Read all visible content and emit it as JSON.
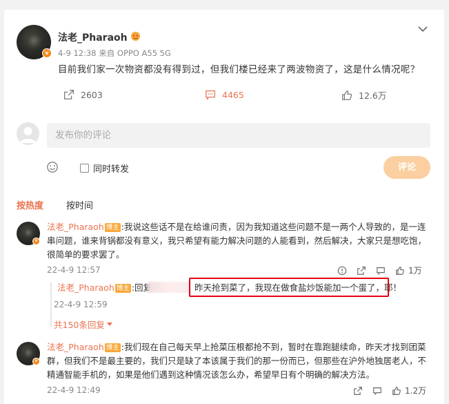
{
  "post": {
    "author": "法老_Pharaoh",
    "meta": "4-9 12:38 来自 OPPO A55 5G",
    "text": "目前我们家一次物资都没有得到过，但我们楼已经来了两波物资了，这是什么情况呢？",
    "repost_count": "2603",
    "comment_count": "4465",
    "like_count": "12.6万"
  },
  "comment_input": {
    "placeholder": "发布你的评论",
    "repost_option": "同时转发",
    "submit": "评论"
  },
  "tabs": [
    "按热度",
    "按时间"
  ],
  "comments": [
    {
      "author": "法老_Pharaoh",
      "tag": "博主",
      "text": ":我说这些话不是在给谁问责，因为我知道这些问题不是一两个人导致的，是一连串问题，谁来背锅都没有意义，我只希望有能力解决问题的人能看到，然后解决，大家只是想吃饱，很简单的要求罢了。",
      "time": "22-4-9 12:57",
      "likes": "1万",
      "reply": {
        "author": "法老_Pharaoh",
        "tag": "博主",
        "prefix": ":回复",
        "text": "昨天抢到菜了，我现在做食盐炒饭能加一个蛋了，耶！",
        "time": "22-4-9 12:59"
      },
      "more_replies": "共150条回复"
    },
    {
      "author": "法老_Pharaoh",
      "tag": "博主",
      "text": ":我们现在自己每天早上抢菜压根都抢不到，暂时在靠跑腿续命，昨天才找到团菜群，但我们不是最主要的，我们只是缺了本该属于我们的那一份而已，但那些在沪外地独居老人，不精通智能手机的，如果是他们遇到这种情况该怎么办，希望早日有个明确的解决方法。",
      "time": "22-4-9 12:49",
      "likes": "1.2万"
    }
  ]
}
